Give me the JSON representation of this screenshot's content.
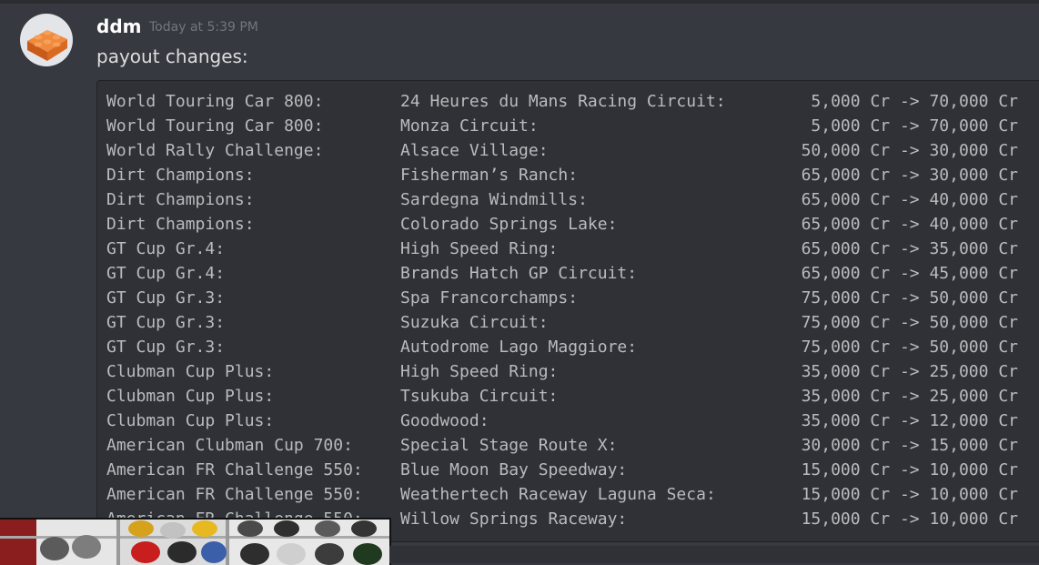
{
  "message": {
    "author": "ddm",
    "timestamp": "Today at 5:39 PM",
    "text": "payout changes:",
    "avatar_icon": "orange-brick-icon",
    "avatar_color": "#e8722a"
  },
  "table": {
    "rows": [
      {
        "series": "World Touring Car 800:",
        "track": "24 Heures du Mans Racing Circuit:",
        "payout": "5,000 Cr -> 70,000 Cr"
      },
      {
        "series": "World Touring Car 800:",
        "track": "Monza Circuit:",
        "payout": "5,000 Cr -> 70,000 Cr"
      },
      {
        "series": "World Rally Challenge:",
        "track": "Alsace Village:",
        "payout": "50,000 Cr -> 30,000 Cr"
      },
      {
        "series": "Dirt Champions:",
        "track": "Fisherman’s Ranch:",
        "payout": "65,000 Cr -> 30,000 Cr"
      },
      {
        "series": "Dirt Champions:",
        "track": "Sardegna Windmills:",
        "payout": "65,000 Cr -> 40,000 Cr"
      },
      {
        "series": "Dirt Champions:",
        "track": "Colorado Springs Lake:",
        "payout": "65,000 Cr -> 40,000 Cr"
      },
      {
        "series": "GT Cup Gr.4:",
        "track": "High Speed Ring:",
        "payout": "65,000 Cr -> 35,000 Cr"
      },
      {
        "series": "GT Cup Gr.4:",
        "track": "Brands Hatch GP Circuit:",
        "payout": "65,000 Cr -> 45,000 Cr"
      },
      {
        "series": "GT Cup Gr.3:",
        "track": "Spa Francorchamps:",
        "payout": "75,000 Cr -> 50,000 Cr"
      },
      {
        "series": "GT Cup Gr.3:",
        "track": "Suzuka Circuit:",
        "payout": "75,000 Cr -> 50,000 Cr"
      },
      {
        "series": "GT Cup Gr.3:",
        "track": "Autodrome Lago Maggiore:",
        "payout": "75,000 Cr -> 50,000 Cr"
      },
      {
        "series": "Clubman Cup Plus:",
        "track": "High Speed Ring:",
        "payout": "35,000 Cr -> 25,000 Cr"
      },
      {
        "series": "Clubman Cup Plus:",
        "track": "Tsukuba Circuit:",
        "payout": "35,000 Cr -> 25,000 Cr"
      },
      {
        "series": "Clubman Cup Plus:",
        "track": "Goodwood:",
        "payout": "35,000 Cr -> 12,000 Cr"
      },
      {
        "series": "American Clubman Cup 700:",
        "track": "Special Stage Route X:",
        "payout": "30,000 Cr -> 15,000 Cr"
      },
      {
        "series": "American FR Challenge 550:",
        "track": "Blue Moon Bay Speedway:",
        "payout": "15,000 Cr -> 10,000 Cr"
      },
      {
        "series": "American FR Challenge 550:",
        "track": "Weathertech Raceway Laguna Seca:",
        "payout": "15,000 Cr -> 10,000 Cr"
      },
      {
        "series": "American FR Challenge 550:",
        "track": "Willow Springs Raceway:",
        "payout": "15,000 Cr -> 10,000 Cr"
      }
    ]
  },
  "webcam": {
    "icon": "webcam-overlay"
  }
}
